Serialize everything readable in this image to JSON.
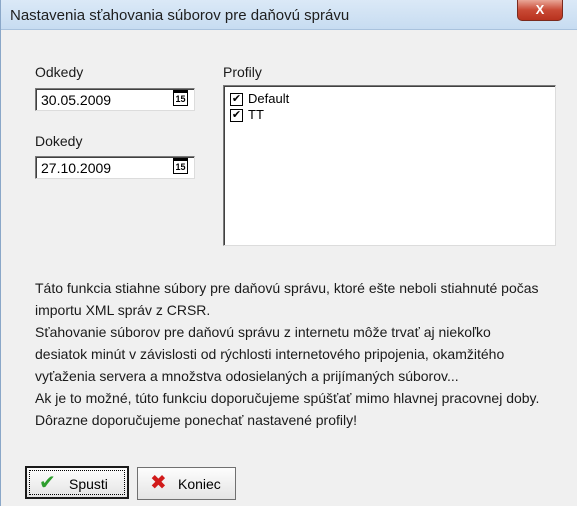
{
  "window": {
    "title": "Nastavenia sťahovania súborov pre daňovú správu",
    "close_symbol": "X"
  },
  "from": {
    "label": "Odkedy",
    "value": "30.05.2009",
    "calendar_glyph": "15"
  },
  "to": {
    "label": "Dokedy",
    "value": "27.10.2009",
    "calendar_glyph": "15"
  },
  "profiles": {
    "label": "Profily",
    "items": [
      {
        "label": "Default",
        "checked": true
      },
      {
        "label": "TT",
        "checked": true
      }
    ]
  },
  "info_lines": [
    "Táto funkcia stiahne súbory pre daňovú správu, ktoré ešte neboli stiahnuté počas",
    "importu XML správ z CRSR.",
    "Sťahovanie súborov pre daňovú správu z internetu môže trvať aj niekoľko",
    "desiatok minút v závislosti od rýchlosti internetového pripojenia, okamžitého",
    "vyťaženia servera a množstva odosielaných a prijímaných súborov...",
    "Ak je to možné, túto funkciu doporučujeme spúšťať mimo hlavnej pracovnej doby.",
    "Dôrazne doporučujeme ponechať nastavené profily!"
  ],
  "buttons": {
    "run_label": "Spusti",
    "run_icon": "checkmark-icon",
    "end_label": "Koniec",
    "end_icon": "x-icon"
  },
  "colors": {
    "run_icon": "#2e9d2e",
    "end_icon": "#d11a1a",
    "close_button": "#c94a35"
  }
}
